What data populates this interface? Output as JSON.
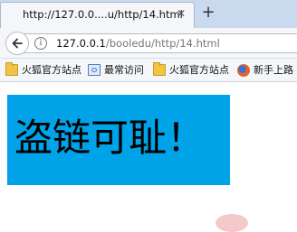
{
  "tab": {
    "title": "http://127.0.0....u/http/14.html",
    "close_glyph": "✕",
    "new_tab_glyph": "+"
  },
  "navbar": {
    "url_host": "127.0.0.1",
    "url_path": "/booledu/http/14.html",
    "info_glyph": "i"
  },
  "bookmarks": [
    {
      "label": "火狐官方站点",
      "icon": "folder-icon"
    },
    {
      "label": "最常访问",
      "icon": "document-icon"
    },
    {
      "label": "火狐官方站点",
      "icon": "folder-icon"
    },
    {
      "label": "新手上路",
      "icon": "firefox-icon"
    }
  ],
  "page": {
    "banner_text": "盗链可耻！",
    "banner_color": "#00a2e8"
  }
}
